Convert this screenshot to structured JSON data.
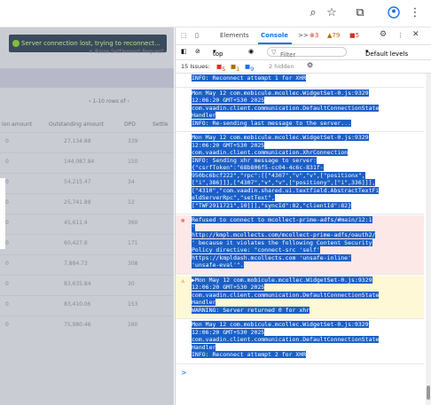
{
  "browser": {
    "icons": [
      "zoom-icon",
      "star-icon",
      "extensions-icon",
      "profile-icon",
      "menu-icon"
    ]
  },
  "app": {
    "toast": "Server connection lost, trying to reconnect...",
    "ghost_button": "Raise Settlement Request",
    "pager": "1-10 rows of",
    "columns": [
      "ion amount",
      "Outstanding amount",
      "DPD",
      "Settle"
    ],
    "rows": [
      [
        "0",
        "27,134.88",
        "339"
      ],
      [
        "0",
        "144,087.84",
        "150"
      ],
      [
        "0",
        "54,215.47",
        "34"
      ],
      [
        "0",
        "25,741.88",
        "12"
      ],
      [
        "0",
        "45,611.4",
        "360"
      ],
      [
        "0",
        "60,427.6",
        "171"
      ],
      [
        "0",
        "7,884.73",
        "308"
      ],
      [
        "0",
        "83,635.84",
        "30"
      ],
      [
        "0",
        "83,410.06",
        "153"
      ],
      [
        "0",
        "75,980.46",
        "160"
      ]
    ]
  },
  "devtools": {
    "tabs": [
      "Elements",
      "Console",
      ">>"
    ],
    "active_tab": "Console",
    "badges": {
      "errors": "3",
      "warnings": "79",
      "issues": "5"
    },
    "toolbar": {
      "context": "top",
      "filter_placeholder": "Filter",
      "levels": "Default levels"
    },
    "issues_bar": {
      "label": "15 Issues:",
      "err": "5",
      "warn": "1",
      "info": "9",
      "hidden": "2 hidden"
    },
    "entries": [
      {
        "type": "log",
        "lines": [
          "INFO: Reconnect attempt 1 for XHR"
        ]
      },
      {
        "type": "log",
        "lines": [
          "Mon May 12  com.mobicule.mcollec.WidgetSet-0.js:9329",
          "12:06:20 GMT+530 2025",
          "com.vaadin.client.communication.DefaultConnectionState",
          "Handler",
          "INFO: Re-sending last message to the server..."
        ]
      },
      {
        "type": "log",
        "lines": [
          "Mon May 12  com.mobicule.mcollec.WidgetSet-0.js:9329",
          "12:06:20 GMT+530 2025",
          "com.vaadin.client.communication.XhrConnection",
          "INFO: Sending xhr message to server:",
          "{\"csrfToken\":\"68b806f5-cc04-4c6c-831f-",
          "950bc6bcf222\",\"rpc\":[[\"4307\",\"v\",\"v\",[\"positionx\",",
          "[\"i\",386]]],[\"4307\",\"v\",\"v\",[\"positiony\",[\"i\",336]]],",
          "[\"4310\",\"com.vaadin.shared.ui.textfield.AbstractTextFi",
          "eldServerRpc\",\"setText\",",
          "[\"TWF2911721\",10]]],\"syncId\":82,\"clientId\":82}"
        ]
      },
      {
        "type": "error",
        "lines": [
          "Refused to connect to   mcollect-prime-adfs/#main/12:1",
          "'",
          "http://kmpl.mcollects.com/mcollect-prime-adfs/oauth2/",
          "' because it violates the following Content Security",
          "Policy directive: \"connect-src 'self'",
          "https://kmpldash.mcollects.com 'unsafe-inline'",
          "'unsafe-eval'\"."
        ]
      },
      {
        "type": "warn",
        "lines": [
          "▶Mon May 12  com.mobicule.mcollec.WidgetSet-0.js:9329",
          "12:06:20 GMT+530 2025",
          "com.vaadin.client.communication.DefaultConnectionState",
          "Handler",
          "WARNING: Server returned 0 for xhr"
        ]
      },
      {
        "type": "log",
        "lines": [
          "Mon May 12  com.mobicule.mcollec.WidgetSet-0.js:9329",
          "12:06:20 GMT+530 2025",
          "com.vaadin.client.communication.DefaultConnectionState",
          "Handler",
          "INFO: Reconnect attempt 2 for XHR"
        ]
      }
    ],
    "prompt": ">"
  }
}
